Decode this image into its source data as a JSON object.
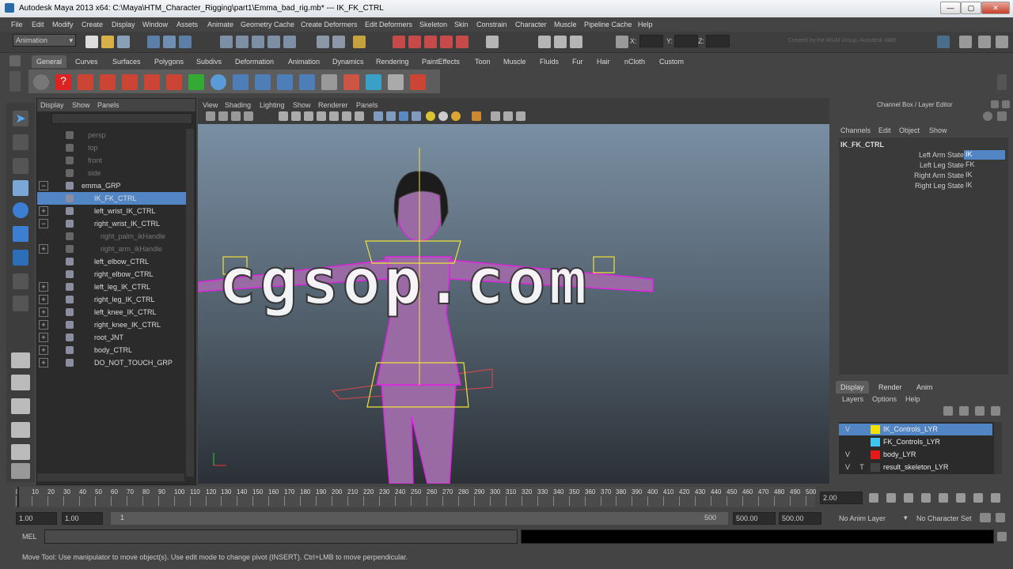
{
  "window": {
    "title": "Autodesk Maya 2013 x64: C:\\Maya\\HTM_Character_Rigging\\part1\\Emma_bad_rig.mb*   ---   IK_FK_CTRL",
    "minimize": "—",
    "maximize": "▢",
    "close": "✕"
  },
  "menu": [
    "File",
    "Edit",
    "Modify",
    "Create",
    "Display",
    "Window",
    "Assets",
    "Animate",
    "Geometry Cache",
    "Create Deformers",
    "Edit Deformers",
    "Skeleton",
    "Skin",
    "Constrain",
    "Character",
    "Muscle",
    "Pipeline Cache",
    "Help"
  ],
  "status": {
    "mode": "Animation",
    "x_label": "X:",
    "y_label": "Y:",
    "z_label": "Z:",
    "credit": "Created by the WUM Group, Autodesk M&E"
  },
  "shelf_tabs": [
    "General",
    "Curves",
    "Surfaces",
    "Polygons",
    "Subdivs",
    "Deformation",
    "Animation",
    "Dynamics",
    "Rendering",
    "PaintEffects",
    "Toon",
    "Muscle",
    "Fluids",
    "Fur",
    "Hair",
    "nCloth",
    "Custom"
  ],
  "outliner": {
    "menus": [
      "Display",
      "Show",
      "Panels"
    ],
    "rows": [
      {
        "label": "persp",
        "dim": true,
        "expander": ""
      },
      {
        "label": "top",
        "dim": true,
        "expander": ""
      },
      {
        "label": "front",
        "dim": true,
        "expander": ""
      },
      {
        "label": "side",
        "dim": true,
        "expander": ""
      },
      {
        "label": "emma_GRP",
        "dim": false,
        "expander": "−"
      },
      {
        "label": "IK_FK_CTRL",
        "dim": false,
        "expander": "",
        "selected": true
      },
      {
        "label": "left_wrist_IK_CTRL",
        "dim": false,
        "expander": "+"
      },
      {
        "label": "right_wrist_IK_CTRL",
        "dim": false,
        "expander": "−"
      },
      {
        "label": "right_palm_ikHandle",
        "dim": true,
        "expander": ""
      },
      {
        "label": "right_arm_ikHandle",
        "dim": true,
        "expander": "+"
      },
      {
        "label": "left_elbow_CTRL",
        "dim": false,
        "expander": ""
      },
      {
        "label": "right_elbow_CTRL",
        "dim": false,
        "expander": ""
      },
      {
        "label": "left_leg_IK_CTRL",
        "dim": false,
        "expander": "+"
      },
      {
        "label": "right_leg_IK_CTRL",
        "dim": false,
        "expander": "+"
      },
      {
        "label": "left_knee_IK_CTRL",
        "dim": false,
        "expander": "+"
      },
      {
        "label": "right_knee_IK_CTRL",
        "dim": false,
        "expander": "+"
      },
      {
        "label": "root_JNT",
        "dim": false,
        "expander": "+"
      },
      {
        "label": "body_CTRL",
        "dim": false,
        "expander": "+"
      },
      {
        "label": "DO_NOT_TOUCH_GRP",
        "dim": false,
        "expander": "+"
      }
    ]
  },
  "viewport": {
    "menus": [
      "View",
      "Shading",
      "Lighting",
      "Show",
      "Renderer",
      "Panels"
    ],
    "watermark": "cgsop.com"
  },
  "channelbox": {
    "title": "Channel Box / Layer Editor",
    "menus": [
      "Channels",
      "Edit",
      "Object",
      "Show"
    ],
    "object": "IK_FK_CTRL",
    "attrs": [
      {
        "name": "Left Arm State",
        "value": "IK"
      },
      {
        "name": "Left Leg State",
        "value": "FK"
      },
      {
        "name": "Right Arm State",
        "value": "IK"
      },
      {
        "name": "Right Leg State",
        "value": "IK"
      }
    ],
    "layer_tabs": [
      "Display",
      "Render",
      "Anim"
    ],
    "layer_menus": [
      "Layers",
      "Options",
      "Help"
    ],
    "layers": [
      {
        "v": "V",
        "p": "",
        "name": "IK_Controls_LYR",
        "color": "#f5e100",
        "selected": true
      },
      {
        "v": "",
        "p": "",
        "name": "FK_Controls_LYR",
        "color": "#3fc6f0",
        "selected": false
      },
      {
        "v": "V",
        "p": "",
        "name": "body_LYR",
        "color": "#e21a1a",
        "selected": false
      },
      {
        "v": "V",
        "p": "T",
        "name": "result_skeleton_LYR",
        "color": "#444444",
        "selected": false
      }
    ]
  },
  "timeline": {
    "ticks": [
      "0",
      "10",
      "20",
      "30",
      "40",
      "50",
      "60",
      "70",
      "80",
      "90",
      "100",
      "110",
      "120",
      "130",
      "140",
      "150",
      "160",
      "170",
      "180",
      "190",
      "200",
      "210",
      "220",
      "230",
      "240",
      "250",
      "260",
      "270",
      "280",
      "290",
      "300",
      "310",
      "320",
      "330",
      "340",
      "350",
      "360",
      "370",
      "380",
      "390",
      "400",
      "410",
      "420",
      "430",
      "440",
      "450",
      "460",
      "470",
      "480",
      "490",
      "500"
    ],
    "current": "2.00"
  },
  "range": {
    "start": "1.00",
    "start2": "1.00",
    "inner_start": "1",
    "inner_end": "500",
    "end": "500.00",
    "end2": "500.00",
    "anim_layer": "No Anim Layer",
    "char_set": "No Character Set"
  },
  "cmd": {
    "label": "MEL"
  },
  "help": {
    "text": "Move Tool: Use manipulator to move object(s). Use edit mode to change pivot (INSERT). Ctrl+LMB to move perpendicular."
  }
}
